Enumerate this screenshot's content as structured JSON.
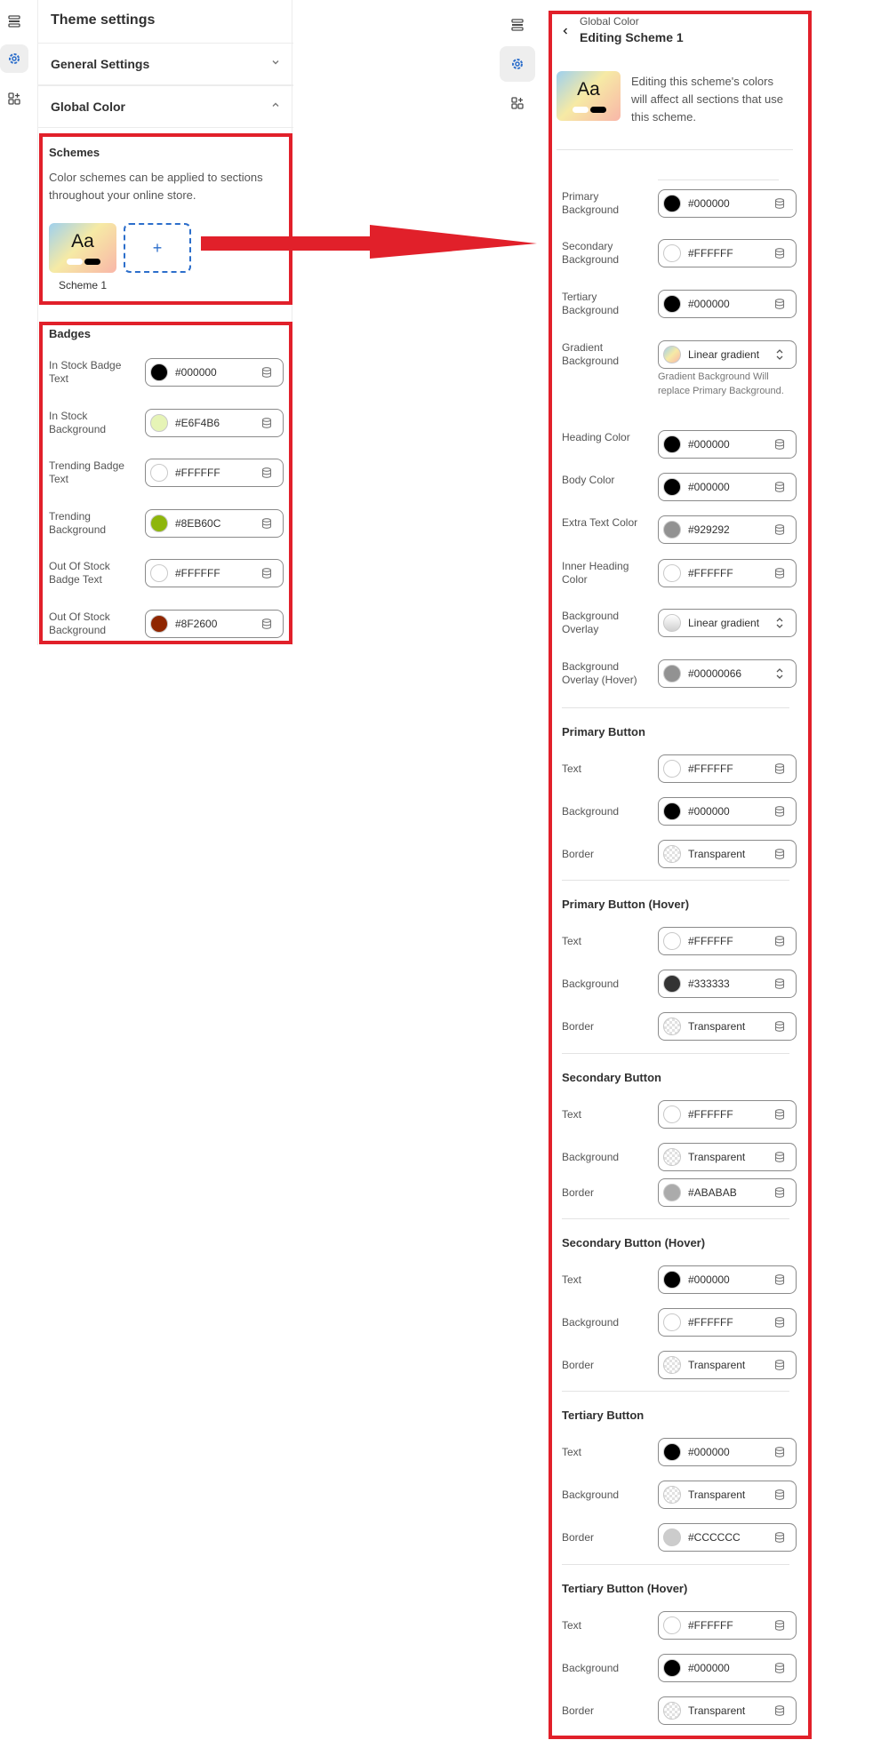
{
  "left": {
    "title": "Theme settings",
    "sections": [
      {
        "label": "General Settings",
        "expanded": false
      },
      {
        "label": "Global Color",
        "expanded": true
      }
    ],
    "schemes": {
      "title": "Schemes",
      "description": "Color schemes can be applied to sections throughout your online store.",
      "thumb_text": "Aa",
      "scheme_name": "Scheme 1",
      "add_label": "+"
    },
    "badges": {
      "title": "Badges",
      "rows": [
        {
          "label": "In Stock Badge Text",
          "value": "#000000",
          "color": "#000000"
        },
        {
          "label": "In Stock Background",
          "value": "#E6F4B6",
          "color": "#E6F4B6"
        },
        {
          "label": "Trending Badge Text",
          "value": "#FFFFFF",
          "color": "#FFFFFF"
        },
        {
          "label": "Trending Background",
          "value": "#8EB60C",
          "color": "#8EB60C"
        },
        {
          "label": "Out Of Stock Badge Text",
          "value": "#FFFFFF",
          "color": "#FFFFFF"
        },
        {
          "label": "Out Of Stock Background",
          "value": "#8F2600",
          "color": "#8F2600"
        }
      ]
    }
  },
  "right": {
    "breadcrumb": "Global Color",
    "title": "Editing Scheme 1",
    "thumb_text": "Aa",
    "info": "Editing this scheme's colors will affect all sections that use this scheme.",
    "gradient_note": "Gradient Background Will replace Primary Background.",
    "rows": [
      {
        "label": "Primary Background",
        "value": "#000000",
        "color": "#000000",
        "icon": "database-icon"
      },
      {
        "label": "Secondary Background",
        "value": "#FFFFFF",
        "color": "#FFFFFF",
        "icon": "database-icon"
      },
      {
        "label": "Tertiary Background",
        "value": "#000000",
        "color": "#000000",
        "icon": "database-icon"
      },
      {
        "label": "Gradient Background",
        "value": "Linear gradient",
        "color": "gradient",
        "icon": "chevron-updown-icon"
      },
      {
        "label": "Heading Color",
        "value": "#000000",
        "color": "#000000",
        "icon": "database-icon"
      },
      {
        "label": "Body Color",
        "value": "#000000",
        "color": "#000000",
        "icon": "database-icon"
      },
      {
        "label": "Extra Text Color",
        "value": "#929292",
        "color": "#929292",
        "icon": "database-icon"
      },
      {
        "label": "Inner Heading Color",
        "value": "#FFFFFF",
        "color": "#FFFFFF",
        "icon": "database-icon"
      },
      {
        "label": "Background Overlay",
        "value": "Linear gradient",
        "color": "gradient-gray",
        "icon": "chevron-updown-icon"
      },
      {
        "label": "Background Overlay (Hover)",
        "value": "#00000066",
        "color": "#929292",
        "icon": "chevron-updown-icon"
      }
    ],
    "sections": [
      {
        "title": "Primary Button",
        "rows": [
          {
            "label": "Text",
            "value": "#FFFFFF",
            "color": "#FFFFFF"
          },
          {
            "label": "Background",
            "value": "#000000",
            "color": "#000000"
          },
          {
            "label": "Border",
            "value": "Transparent",
            "color": "transparent"
          }
        ]
      },
      {
        "title": "Primary Button (Hover)",
        "rows": [
          {
            "label": "Text",
            "value": "#FFFFFF",
            "color": "#FFFFFF"
          },
          {
            "label": "Background",
            "value": "#333333",
            "color": "#333333"
          },
          {
            "label": "Border",
            "value": "Transparent",
            "color": "transparent"
          }
        ]
      },
      {
        "title": "Secondary Button",
        "rows": [
          {
            "label": "Text",
            "value": "#FFFFFF",
            "color": "#FFFFFF"
          },
          {
            "label": "Background",
            "value": "Transparent",
            "color": "transparent"
          },
          {
            "label": "Border",
            "value": "#ABABAB",
            "color": "#ABABAB"
          }
        ]
      },
      {
        "title": "Secondary Button (Hover)",
        "rows": [
          {
            "label": "Text",
            "value": "#000000",
            "color": "#000000"
          },
          {
            "label": "Background",
            "value": "#FFFFFF",
            "color": "#FFFFFF"
          },
          {
            "label": "Border",
            "value": "Transparent",
            "color": "transparent"
          }
        ]
      },
      {
        "title": "Tertiary Button",
        "rows": [
          {
            "label": "Text",
            "value": "#000000",
            "color": "#000000"
          },
          {
            "label": "Background",
            "value": "Transparent",
            "color": "transparent"
          },
          {
            "label": "Border",
            "value": "#CCCCCC",
            "color": "#CCCCCC"
          }
        ]
      },
      {
        "title": "Tertiary Button (Hover)",
        "rows": [
          {
            "label": "Text",
            "value": "#FFFFFF",
            "color": "#FFFFFF"
          },
          {
            "label": "Background",
            "value": "#000000",
            "color": "#000000"
          },
          {
            "label": "Border",
            "value": "Transparent",
            "color": "transparent"
          }
        ]
      }
    ]
  },
  "colors": {
    "annotation_red": "#E1202A",
    "accent_blue": "#2C6ECB"
  }
}
